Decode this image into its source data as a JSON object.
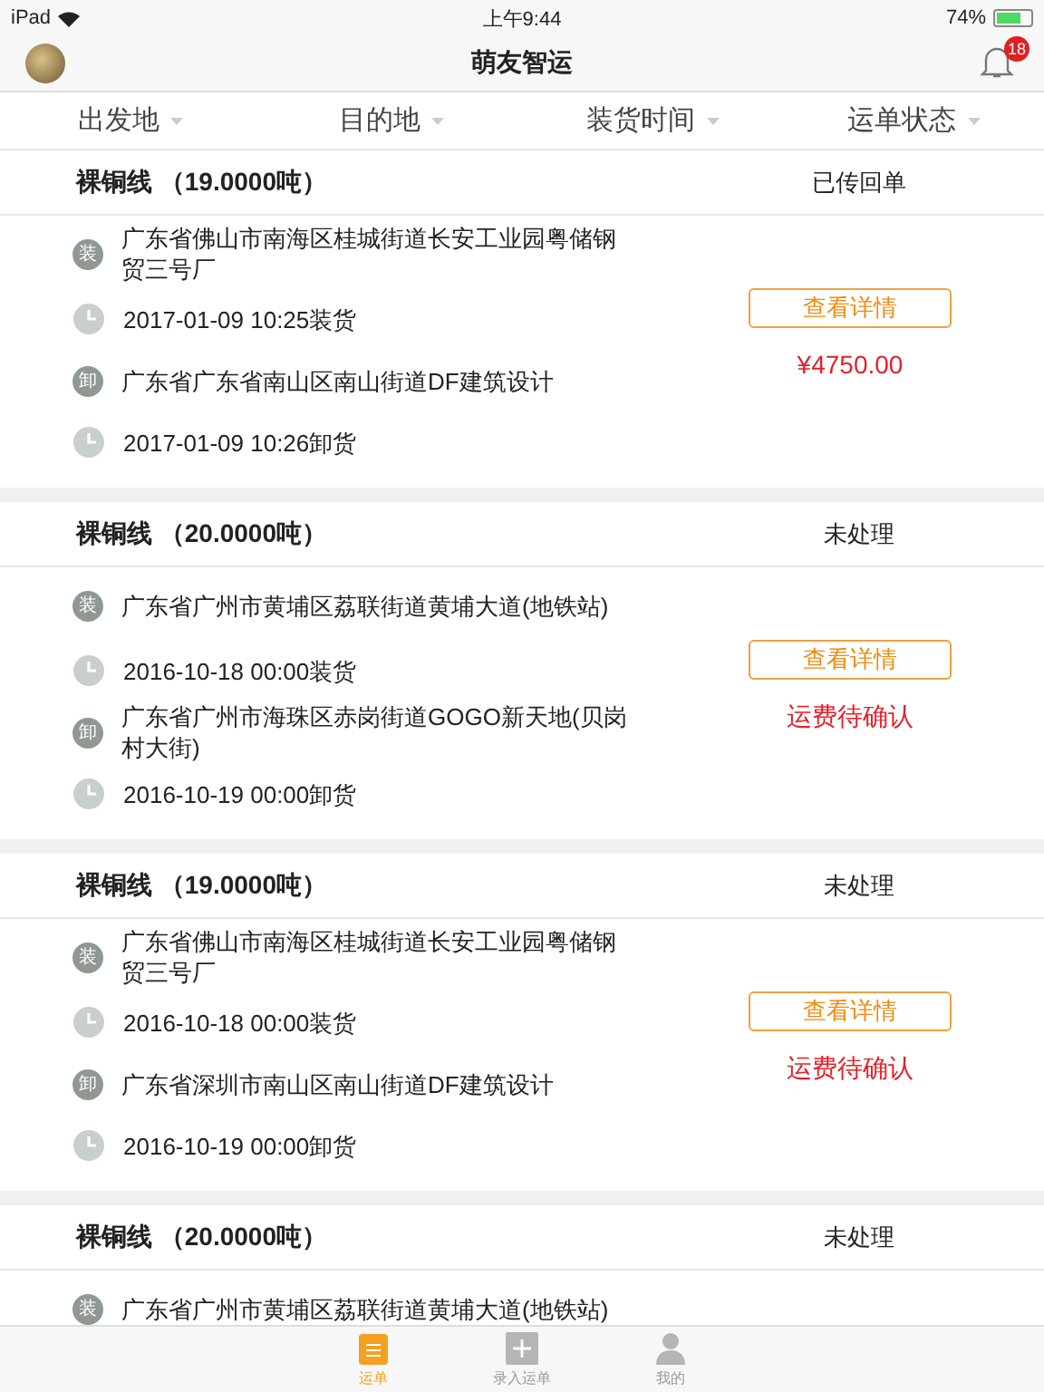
{
  "status_bar": {
    "device": "iPad",
    "time": "上午9:44",
    "battery": "74%"
  },
  "nav": {
    "title": "萌友智运",
    "badge": "18"
  },
  "filters": [
    {
      "label": "出发地"
    },
    {
      "label": "目的地"
    },
    {
      "label": "装货时间"
    },
    {
      "label": "运单状态"
    }
  ],
  "orders": [
    {
      "title": "裸铜线 （19.0000吨）",
      "status": "已传回单",
      "action": "查看详情",
      "fee": "¥4750.00",
      "rows": [
        {
          "kind": "address",
          "badge": "装",
          "text": "广东省佛山市南海区桂城街道长安工业园粤储钢贸三号厂"
        },
        {
          "kind": "time",
          "text": "2017-01-09 10:25装货"
        },
        {
          "kind": "address",
          "badge": "卸",
          "text": "广东省广东省南山区南山街道DF建筑设计"
        },
        {
          "kind": "time",
          "text": "2017-01-09 10:26卸货"
        }
      ]
    },
    {
      "title": "裸铜线 （20.0000吨）",
      "status": "未处理",
      "action": "查看详情",
      "fee": "运费待确认",
      "rows": [
        {
          "kind": "address",
          "badge": "装",
          "text": "广东省广州市黄埔区荔联街道黄埔大道(地铁站)"
        },
        {
          "kind": "time",
          "text": "2016-10-18 00:00装货"
        },
        {
          "kind": "address",
          "badge": "卸",
          "text": "广东省广州市海珠区赤岗街道GOGO新天地(贝岗村大街)"
        },
        {
          "kind": "time",
          "text": "2016-10-19 00:00卸货"
        }
      ]
    },
    {
      "title": "裸铜线 （19.0000吨）",
      "status": "未处理",
      "action": "查看详情",
      "fee": "运费待确认",
      "rows": [
        {
          "kind": "address",
          "badge": "装",
          "text": "广东省佛山市南海区桂城街道长安工业园粤储钢贸三号厂"
        },
        {
          "kind": "time",
          "text": "2016-10-18 00:00装货"
        },
        {
          "kind": "address",
          "badge": "卸",
          "text": "广东省深圳市南山区南山街道DF建筑设计"
        },
        {
          "kind": "time",
          "text": "2016-10-19 00:00卸货"
        }
      ]
    },
    {
      "title": "裸铜线 （20.0000吨）",
      "status": "未处理",
      "rows": [
        {
          "kind": "address",
          "badge": "装",
          "text": "广东省广州市黄埔区荔联街道黄埔大道(地铁站)"
        }
      ]
    }
  ],
  "tabs": [
    {
      "label": "运单",
      "selected": true,
      "kind": "list"
    },
    {
      "label": "录入运单",
      "selected": false,
      "kind": "add"
    },
    {
      "label": "我的",
      "selected": false,
      "kind": "person"
    }
  ]
}
